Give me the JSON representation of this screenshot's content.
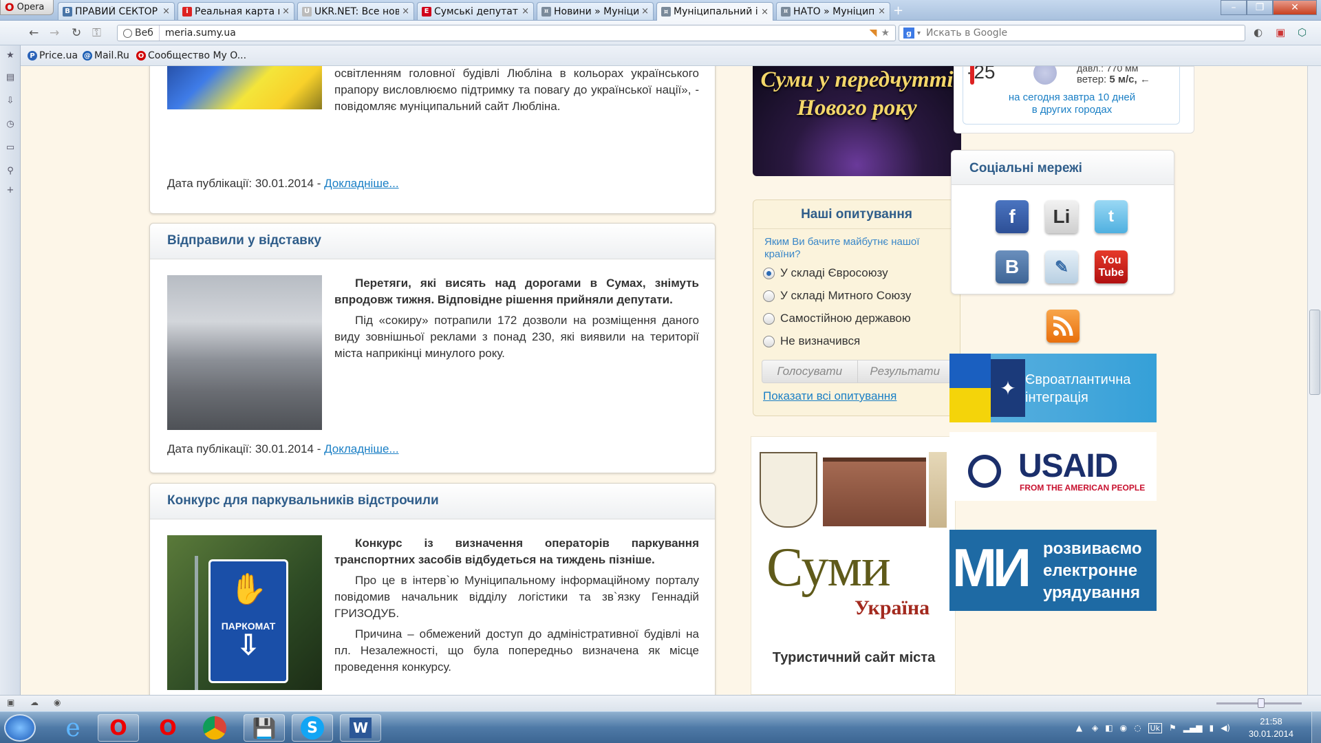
{
  "browser": {
    "menu_label": "Opera",
    "tabs": [
      {
        "title": "ПРАВИЙ СЕКТОР",
        "icon": "vk-icon"
      },
      {
        "title": "Реальная карта п...",
        "icon": "info-icon"
      },
      {
        "title": "UKR.NET: Все нов...",
        "icon": "ukrnet-icon"
      },
      {
        "title": "Сумські депутати ...",
        "icon": "e-icon"
      },
      {
        "title": "Новини » Муніци...",
        "icon": "emblem-icon"
      },
      {
        "title": "Муніципальний і...",
        "icon": "emblem-icon"
      },
      {
        "title": "НАТО » Муніцип...",
        "icon": "emblem-icon"
      }
    ],
    "address": {
      "web_label": "Веб",
      "url": "meria.sumy.ua"
    },
    "search_placeholder": "Искать в Google",
    "bookmarks": [
      "Price.ua",
      "Mail.Ru",
      "Сообщество My O..."
    ]
  },
  "news": [
    {
      "title": "",
      "lead": "",
      "body": [
        "«Зважаючи на довготривале культурне і політичне співробітництво зі східним сусідом, таким символічним освітленням головної будівлі Любліна в кольорах українського прапору висловлюємо підтримку та повагу до української нації», - повідомляє муніципальний сайт Любліна."
      ],
      "date_label": "Дата публікації: 30.01.2014 - ",
      "more": "Докладніше..."
    },
    {
      "title": "Відправили у відставку",
      "lead": "Перетяги, які висять над дорогами в Сумах, знімуть впродовж тижня. Відповідне рішення прийняли депутати.",
      "body": [
        "Під «сокиру» потрапили 172 дозволи на розміщення даного виду зовнішньої реклами з понад 230, які виявили на території міста наприкінці минулого року."
      ],
      "date_label": "Дата публікації: 30.01.2014 - ",
      "more": "Докладніше..."
    },
    {
      "title": "Конкурс для паркувальників відстрочили",
      "lead": "Конкурс із визначення операторів паркування транспортних засобів відбудеться на тиждень пізніше.",
      "body": [
        "Про це в інтерв`ю Муніципальному інформаційному порталу повідомив начальник відділу логістики та зв`язку Геннадій ГРИЗОДУБ.",
        "Причина – обмежений доступ до адміністративної будівлі на пл. Незалежності, що була попередньо визначена як місце проведення конкурсу."
      ],
      "parking_sign": "ПАРКОМАТ"
    }
  ],
  "newyear_banner": "Суми у передчутті Нового року",
  "poll": {
    "title": "Наші опитування",
    "question": "Яким Ви бачите майбутнє нашої країни?",
    "options": [
      {
        "label": "У складі Євросоюзу",
        "selected": true
      },
      {
        "label": "У складі Митного Союзу",
        "selected": false
      },
      {
        "label": "Самостійною державою",
        "selected": false
      },
      {
        "label": "Не визначився",
        "selected": false
      }
    ],
    "vote_label": "Голосувати",
    "results_label": "Результати",
    "all_polls_link": "Показати всі опитування"
  },
  "tourism": {
    "title": "Суми",
    "subtitle": "Україна",
    "caption": "Туристичний сайт міста"
  },
  "weather": {
    "temperature": "-25",
    "pressure_label": "давл.: 770 мм",
    "wind_label": "ветер:",
    "wind_value": "5 м/с,",
    "links": "на сегодня  завтра  10 дней",
    "other_cities": "в других городах"
  },
  "social": {
    "title": "Соціальні мережі",
    "icons": [
      "facebook-icon",
      "linkedin-icon",
      "twitter-icon",
      "vkontakte-icon",
      "livejournal-icon",
      "youtube-icon"
    ],
    "linkedin_text": "Li",
    "vk_text": "В",
    "youtube_text": [
      "You",
      "Tube"
    ]
  },
  "banners": {
    "nato": "Євроатлантична інтеграція",
    "usaid": {
      "title": "USAID",
      "tagline": "FROM THE AMERICAN PEOPLE"
    },
    "egov": {
      "logo": "МИ",
      "text": "розвиваємо електронне урядування"
    }
  },
  "taskbar": {
    "time": "21:58",
    "date": "30.01.2014",
    "lang": "Uk"
  }
}
